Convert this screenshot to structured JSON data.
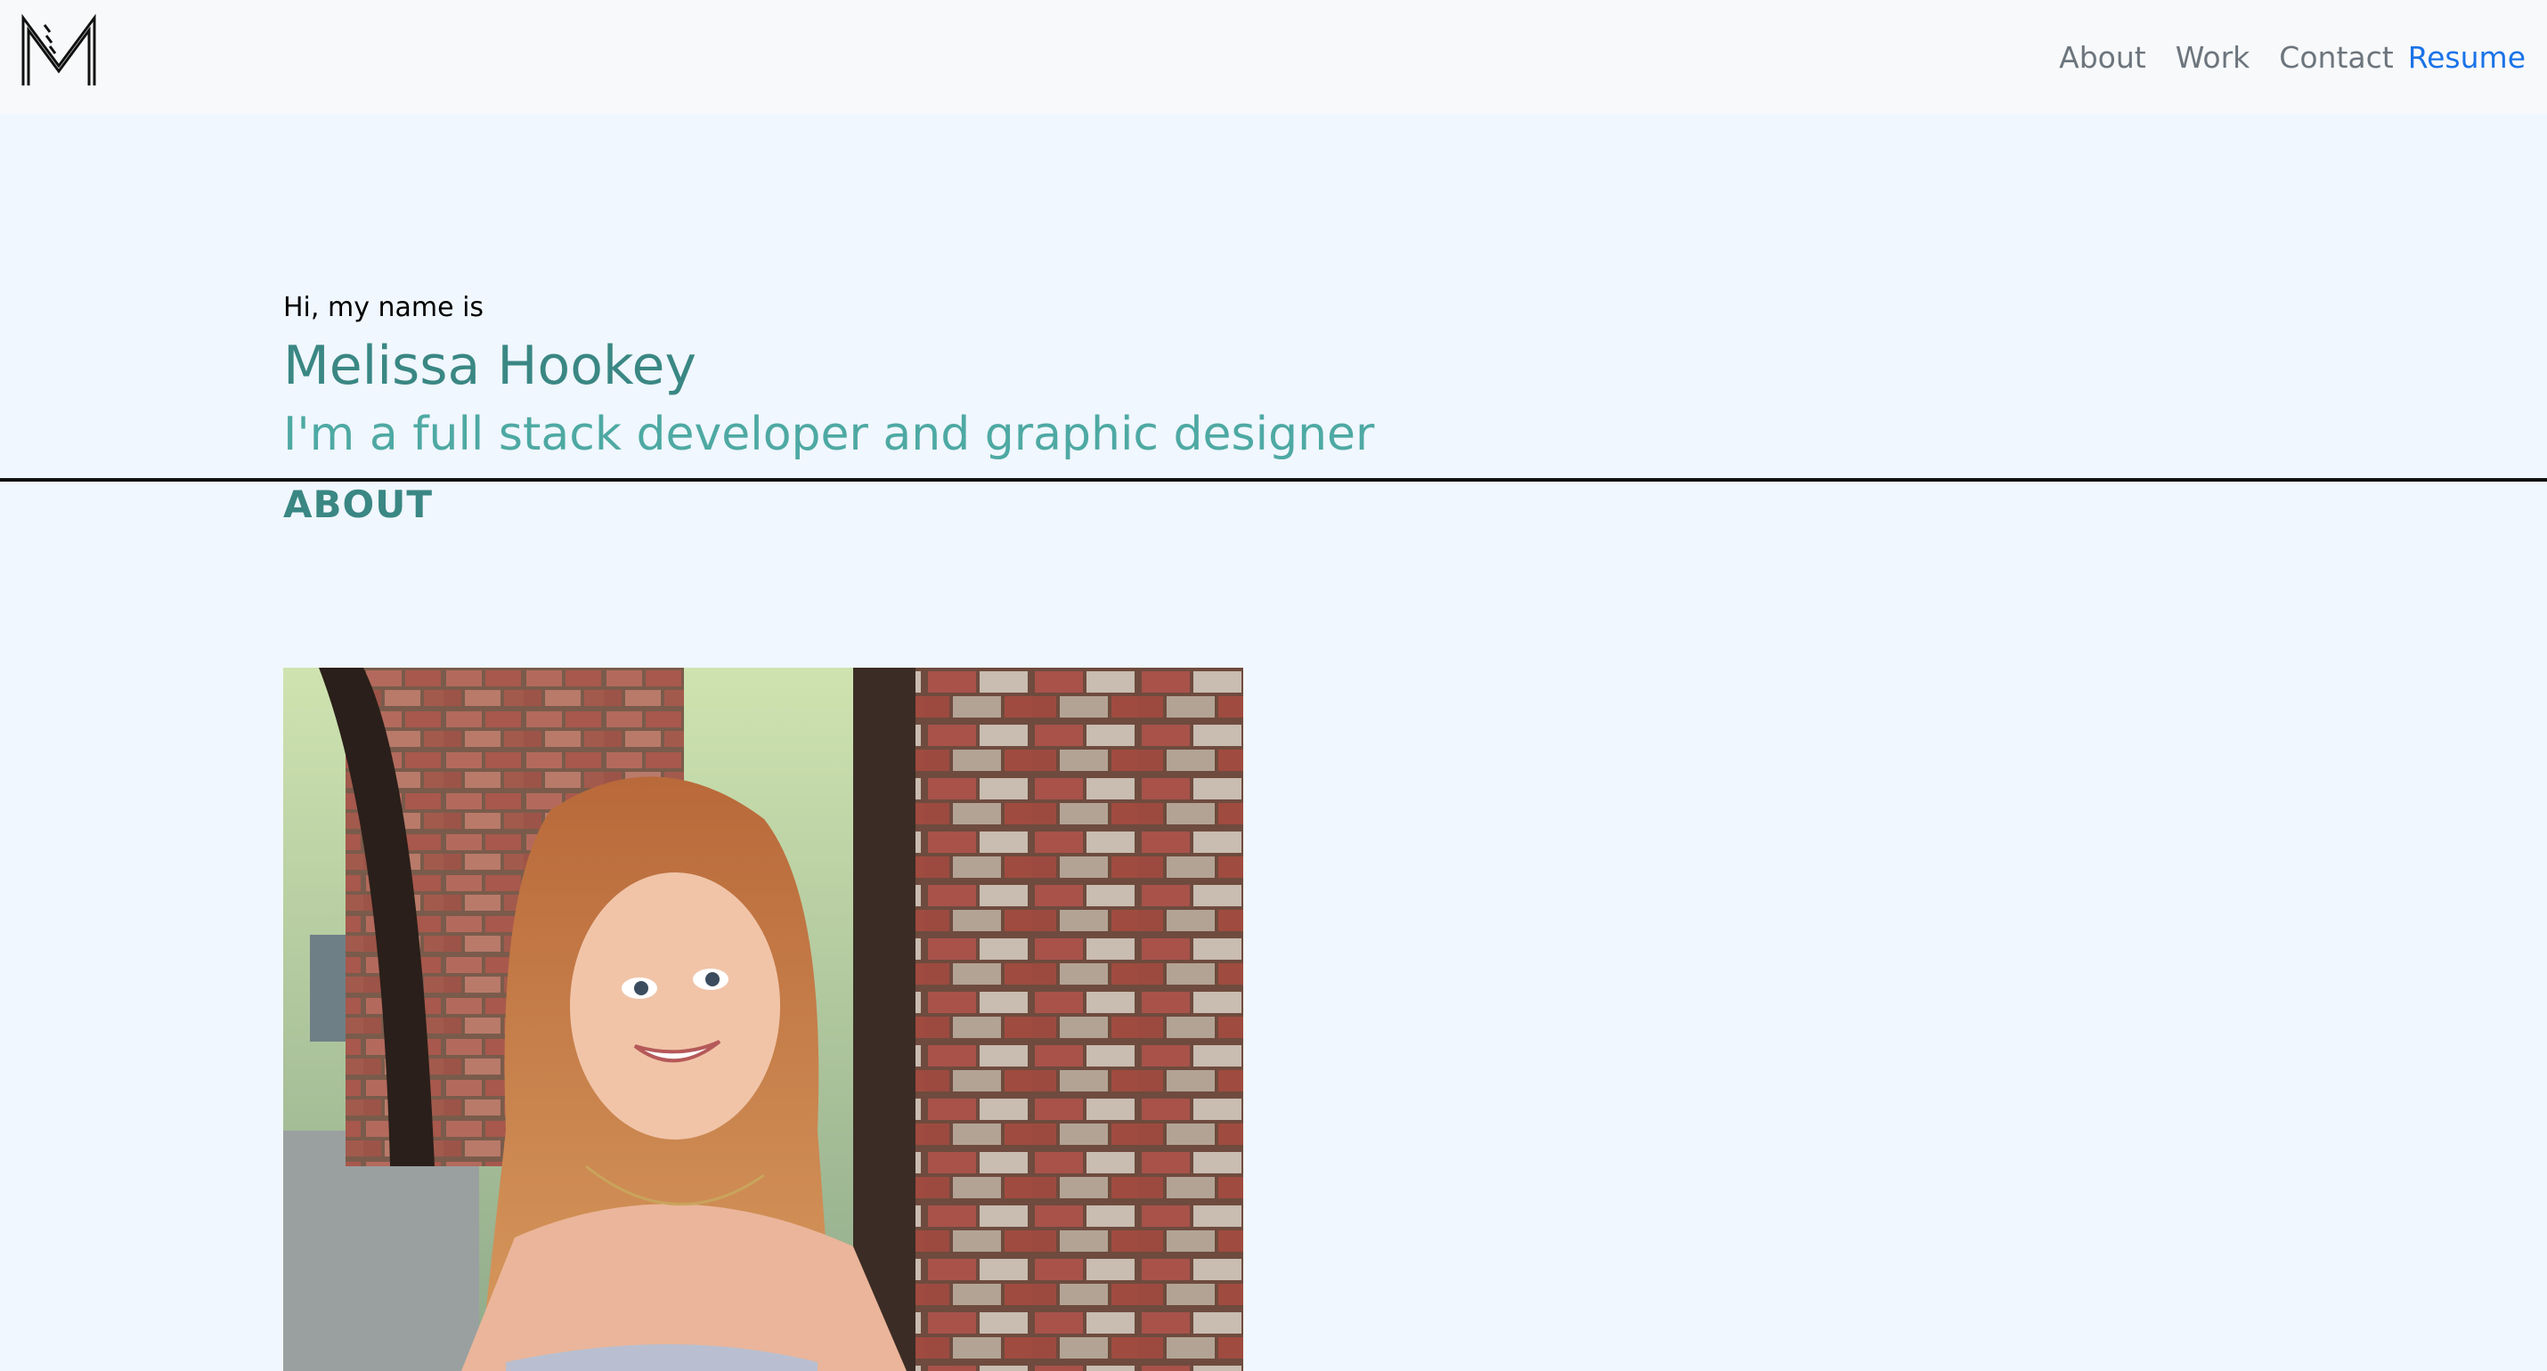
{
  "nav": {
    "logo_icon": "m-monogram-logo",
    "links": [
      {
        "label": "About"
      },
      {
        "label": "Work"
      },
      {
        "label": "Contact"
      },
      {
        "label": "Resume"
      }
    ]
  },
  "hero": {
    "greeting": "Hi, my name is",
    "name": "Melissa Hookey",
    "tagline": "I'm a full stack developer and graphic designer"
  },
  "about": {
    "heading": "ABOUT",
    "photo_alt": "Portrait photo"
  },
  "colors": {
    "page_bg": "#f0f7fe",
    "navbar_bg": "#f8f9fa",
    "accent_dark": "#3a8784",
    "accent_light": "#4ea9a3",
    "link": "#6c757d",
    "resume_link": "#1a73e8"
  }
}
